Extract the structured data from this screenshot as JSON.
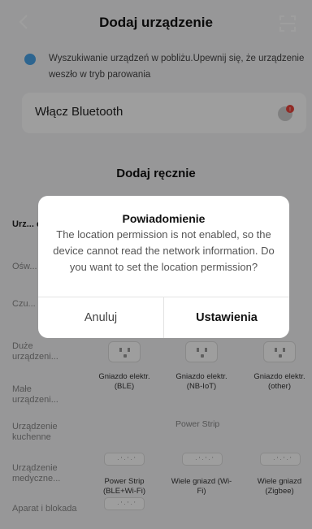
{
  "header": {
    "title": "Dodaj urządzenie"
  },
  "search": {
    "text": "Wyszukiwanie urządzeń w pobliżu.Upewnij się, że urządzenie weszło w tryb parowania"
  },
  "bluetooth": {
    "label": "Włącz Bluetooth"
  },
  "manual": {
    "title": "Dodaj ręcznie"
  },
  "categories": [
    "Urz... elek...",
    "Ośw...",
    "Czu... och...",
    "Duże urządzeni...",
    "Małe urządzeni...",
    "Urządzenie kuchenne",
    "Urządzenie medyczne...",
    "Aparat i blokada"
  ],
  "products": {
    "row1": [
      "Gniazdo elektr. (BLE)",
      "Gniazdo elektr. (NB-IoT)",
      "Gniazdo elektr. (other)"
    ],
    "section": "Power Strip",
    "row2": [
      "Power Strip (BLE+Wi-Fi)",
      "Wiele gniazd (Wi-Fi)",
      "Wiele gniazd (Zigbee)"
    ],
    "partial_right": [
      "o",
      ")"
    ]
  },
  "dialog": {
    "title": "Powiadomienie",
    "message": "The location permission is not enabled, so the device cannot read the network information. Do you want to set the location permission?",
    "cancel": "Anuluj",
    "confirm": "Ustawienia"
  },
  "colors": {
    "accent": "#4aa4e8",
    "badge": "#e8453c"
  }
}
